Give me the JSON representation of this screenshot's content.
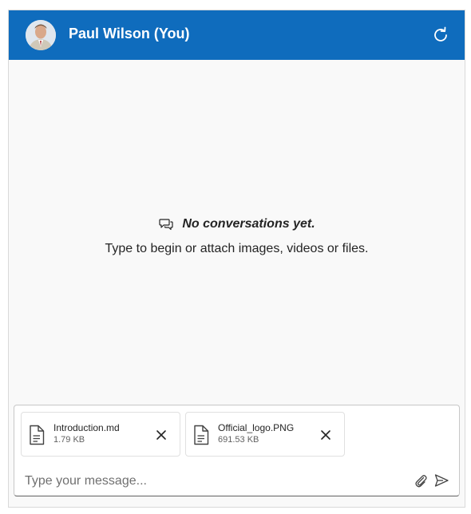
{
  "header": {
    "title": "Paul Wilson (You)",
    "avatar_icon": "user-avatar-photo",
    "refresh_icon": "refresh-icon",
    "bg_color": "#0f6cbd"
  },
  "empty_state": {
    "icon": "chat-bubbles-icon",
    "title": "No conversations yet.",
    "subtitle": "Type to begin or attach images, videos or files."
  },
  "composer": {
    "placeholder": "Type your message...",
    "attach_icon": "paperclip-icon",
    "send_icon": "send-icon",
    "attachments": [
      {
        "name": "Introduction.md",
        "size": "1.79 KB",
        "icon": "document-icon"
      },
      {
        "name": "Official_logo.PNG",
        "size": "691.53 KB",
        "icon": "document-icon"
      }
    ]
  }
}
